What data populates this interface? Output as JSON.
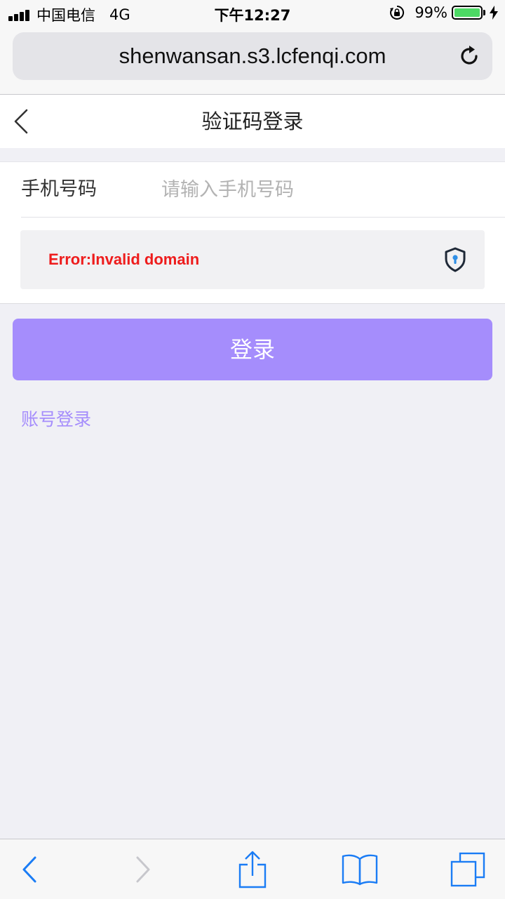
{
  "status_bar": {
    "carrier": "中国电信",
    "network": "4G",
    "time": "下午12:27",
    "battery_percent": "99%",
    "battery_level": 0.99,
    "battery_color": "#4cd964"
  },
  "browser": {
    "url": "shenwansan.s3.lcfenqi.com",
    "reload_icon": "reload-icon"
  },
  "header": {
    "title": "验证码登录",
    "back_icon": "chevron-left-icon"
  },
  "form": {
    "phone_label": "手机号码",
    "phone_value": "",
    "phone_placeholder": "请输入手机号码",
    "captcha_error": "Error:Invalid domain",
    "captcha_icon": "shield-keyhole-icon"
  },
  "actions": {
    "login_label": "登录",
    "account_login_label": "账号登录",
    "accent_color": "#a58dfc"
  },
  "toolbar": {
    "items": [
      "back-icon",
      "forward-icon",
      "share-icon",
      "bookmarks-icon",
      "tabs-icon"
    ]
  }
}
